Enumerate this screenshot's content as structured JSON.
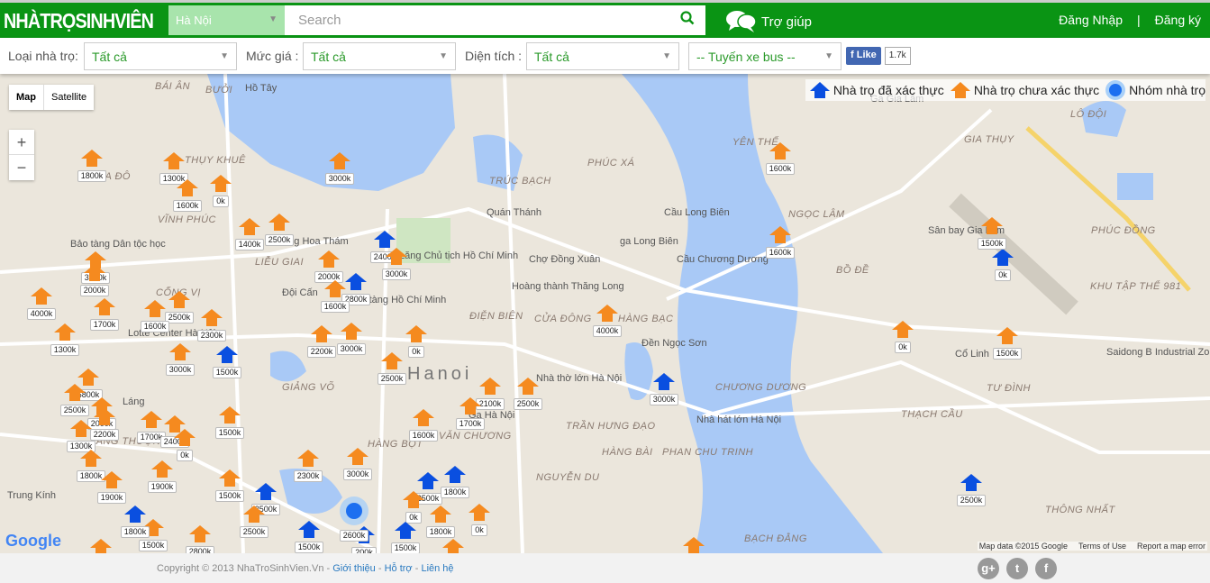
{
  "header": {
    "logo": "NHÀTRỌSINHVIÊN",
    "city": "Hà Nội",
    "search_placeholder": "Search",
    "help": "Trợ giúp",
    "login": "Đăng Nhập",
    "separator": "|",
    "register": "Đăng ký"
  },
  "filters": {
    "type_label": "Loại nhà trọ:",
    "type_value": "Tất cả",
    "price_label": "Mức giá :",
    "price_value": "Tất cả",
    "area_label": "Diện tích :",
    "area_value": "Tất cả",
    "bus_value": "-- Tuyến xe bus --",
    "fb_like": "Like",
    "fb_count": "1.7k"
  },
  "legend": {
    "verified": "Nhà trọ đã xác thực",
    "unverified": "Nhà trọ chưa xác thực",
    "group": "Nhóm nhà trọ"
  },
  "colors": {
    "brand": "#0a9414",
    "verified": "#0a4fe0",
    "unverified": "#f58a1f",
    "water": "#a9c9f6"
  },
  "map_controls": {
    "map": "Map",
    "satellite": "Satellite",
    "zoom_in": "+",
    "zoom_out": "−",
    "google": "Google",
    "map_data": "Map data ©2015 Google",
    "terms": "Terms of Use",
    "report": "Report a map error"
  },
  "places": [
    "BÁI ÂN",
    "BƯỞI",
    "Hồ Tây",
    "THỤY KHUÊ",
    "NGHĨA ĐÔ",
    "VĨNH PHÚC",
    "Bảo tàng Dân tộc học",
    "LIỄU GIAI",
    "Hoàng Hoa Thám",
    "Lăng Chủ tịch Hồ Chí Minh",
    "Đội Cấn",
    "Bảo tàng Hồ Chí Minh",
    "TRÚC BẠCH",
    "Quán Thánh",
    "PHÚC XÁ",
    "Cầu Long Biên",
    "ga Long Biên",
    "Chợ Đồng Xuân",
    "Hoàng thành Thăng Long",
    "ĐIỆN BIÊN",
    "CỬA ĐÔNG",
    "HÀNG BẠC",
    "Đền Ngọc Sơn",
    "Hanoi",
    "Nhà thờ lớn Hà Nội",
    "Ga Hà Nội",
    "Nhà hát lớn Hà Nội",
    "VĂN CHƯƠNG",
    "TRẦN HƯNG ĐẠO",
    "HÀNG BÀI",
    "PHAN CHU TRINH",
    "NGUYỄN DU",
    "HÀNG BỘT",
    "GIẢNG VÕ",
    "CHƯƠNG DƯƠNG",
    "Cầu Chương Dương",
    "NGỌC LÂM",
    "YÊN THẾ",
    "GIA THỤY",
    "Sân bay Gia Lâm",
    "PHÚC ĐỒNG",
    "BỒ ĐỀ",
    "KHU TẬP THỂ 981",
    "Cổ Linh",
    "Saidong B Industrial Zone",
    "TƯ ĐÌNH",
    "THẠCH CẦU",
    "LÁNG THƯỢNG",
    "Láng",
    "Lotte Center Hà Nội",
    "CỐNG VỊ",
    "Trung Kính",
    "BẠCH ĐẰNG",
    "THÔNG NHẤT",
    "Ga Gia Lâm",
    "LÔ ĐỘI"
  ],
  "markers": [
    {
      "price": "1800k",
      "type": "unverified"
    },
    {
      "price": "1300k",
      "type": "unverified"
    },
    {
      "price": "1600k",
      "type": "unverified"
    },
    {
      "price": "0k",
      "type": "unverified"
    },
    {
      "price": "3000k",
      "type": "unverified"
    },
    {
      "price": "1400k",
      "type": "unverified"
    },
    {
      "price": "2500k",
      "type": "unverified"
    },
    {
      "price": "2400k",
      "type": "verified"
    },
    {
      "price": "3000k",
      "type": "unverified"
    },
    {
      "price": "2000k",
      "type": "unverified"
    },
    {
      "price": "2800k",
      "type": "verified"
    },
    {
      "price": "1600k",
      "type": "unverified"
    },
    {
      "price": "3300k",
      "type": "unverified"
    },
    {
      "price": "2000k",
      "type": "unverified"
    },
    {
      "price": "4000k",
      "type": "unverified"
    },
    {
      "price": "1700k",
      "type": "unverified"
    },
    {
      "price": "2500k",
      "type": "unverified"
    },
    {
      "price": "1600k",
      "type": "unverified"
    },
    {
      "price": "2300k",
      "type": "unverified"
    },
    {
      "price": "1300k",
      "type": "unverified"
    },
    {
      "price": "3000k",
      "type": "unverified"
    },
    {
      "price": "1500k",
      "type": "verified"
    },
    {
      "price": "2200k",
      "type": "unverified"
    },
    {
      "price": "3000k",
      "type": "unverified"
    },
    {
      "price": "0k",
      "type": "unverified"
    },
    {
      "price": "2500k",
      "type": "unverified"
    },
    {
      "price": "5800k",
      "type": "unverified"
    },
    {
      "price": "2500k",
      "type": "unverified"
    },
    {
      "price": "2000k",
      "type": "unverified"
    },
    {
      "price": "2200k",
      "type": "unverified"
    },
    {
      "price": "1300k",
      "type": "unverified"
    },
    {
      "price": "1700k",
      "type": "unverified"
    },
    {
      "price": "2400k",
      "type": "unverified"
    },
    {
      "price": "0k",
      "type": "unverified"
    },
    {
      "price": "1500k",
      "type": "unverified"
    },
    {
      "price": "1800k",
      "type": "unverified"
    },
    {
      "price": "1900k",
      "type": "unverified"
    },
    {
      "price": "1900k",
      "type": "unverified"
    },
    {
      "price": "2100k",
      "type": "unverified"
    },
    {
      "price": "2500k",
      "type": "unverified"
    },
    {
      "price": "1700k",
      "type": "unverified"
    },
    {
      "price": "1600k",
      "type": "unverified"
    },
    {
      "price": "2300k",
      "type": "unverified"
    },
    {
      "price": "3000k",
      "type": "unverified"
    },
    {
      "price": "2500k",
      "type": "verified"
    },
    {
      "price": "1800k",
      "type": "verified"
    },
    {
      "price": "0k",
      "type": "unverified"
    },
    {
      "price": "1800k",
      "type": "unverified"
    },
    {
      "price": "0k",
      "type": "unverified"
    },
    {
      "price": "2500k",
      "type": "verified"
    },
    {
      "price": "2500k",
      "type": "unverified"
    },
    {
      "price": "1500k",
      "type": "verified"
    },
    {
      "price": "200k",
      "type": "verified"
    },
    {
      "price": "1500k",
      "type": "verified"
    },
    {
      "price": "2800k",
      "type": "unverified"
    },
    {
      "price": "2000k",
      "type": "unverified"
    },
    {
      "price": "1500k",
      "type": "unverified"
    },
    {
      "price": "1800k",
      "type": "verified"
    },
    {
      "price": "2000k",
      "type": "unverified"
    },
    {
      "price": "4000k",
      "type": "unverified"
    },
    {
      "price": "3000k",
      "type": "verified"
    },
    {
      "price": "1500k",
      "type": "unverified"
    },
    {
      "price": "4000k",
      "type": "unverified"
    },
    {
      "price": "1600k",
      "type": "unverified"
    },
    {
      "price": "1600k",
      "type": "unverified"
    },
    {
      "price": "1500k",
      "type": "unverified"
    },
    {
      "price": "0k",
      "type": "verified"
    },
    {
      "price": "0k",
      "type": "unverified"
    },
    {
      "price": "1500k",
      "type": "unverified"
    },
    {
      "price": "2500k",
      "type": "verified"
    },
    {
      "price": "2600k",
      "type": "group"
    }
  ],
  "footer": {
    "copyright": "Copyright © 2013 NhaTroSinhVien.Vn -",
    "about": "Giới thiệu",
    "sep1": "-",
    "support": "Hỗ trợ",
    "sep2": "-",
    "contact": "Liên hệ",
    "gplus": "g+",
    "twitter": "t",
    "facebook": "f"
  }
}
